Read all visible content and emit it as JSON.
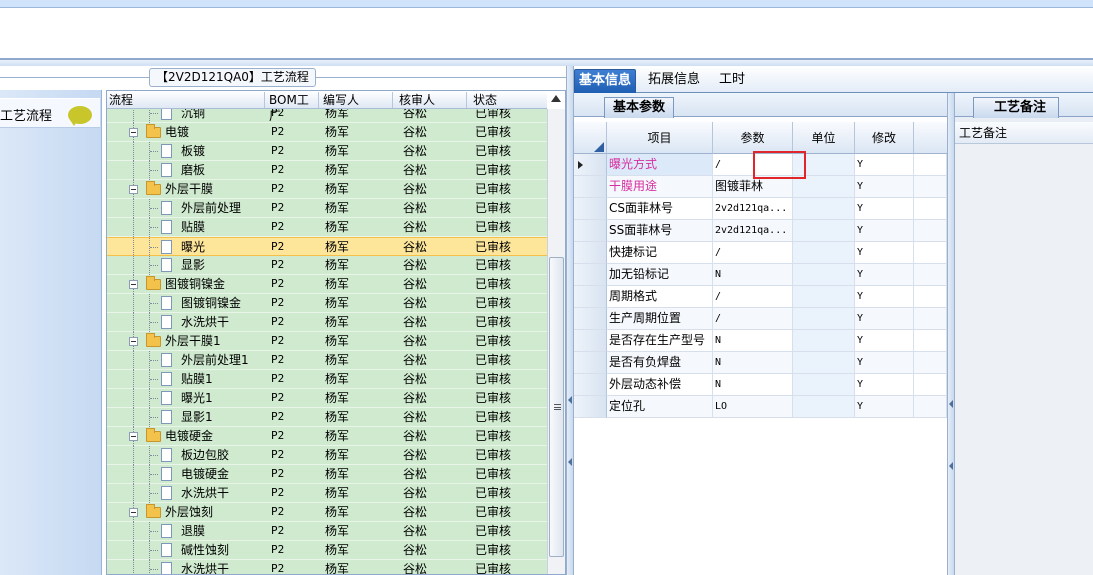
{
  "top_strip_text": "... P2 P2 ...",
  "tree": {
    "title": "【2V2D121QA0】工艺流程",
    "columns": {
      "flow": "流程",
      "bom": "BOM工厂",
      "writer": "编写人",
      "checker": "核审人",
      "status": "状态"
    },
    "rows": [
      {
        "label": "沉铜",
        "kind": "leaf",
        "bom": "P2",
        "writer": "杨军",
        "checker": "谷松",
        "status": "已审核"
      },
      {
        "label": "电镀",
        "kind": "folder",
        "bom": "P2",
        "writer": "杨军",
        "checker": "谷松",
        "status": "已审核"
      },
      {
        "label": "板镀",
        "kind": "leaf",
        "bom": "P2",
        "writer": "杨军",
        "checker": "谷松",
        "status": "已审核"
      },
      {
        "label": "磨板",
        "kind": "leaf",
        "bom": "P2",
        "writer": "杨军",
        "checker": "谷松",
        "status": "已审核"
      },
      {
        "label": "外层干膜",
        "kind": "folder",
        "bom": "P2",
        "writer": "杨军",
        "checker": "谷松",
        "status": "已审核"
      },
      {
        "label": "外层前处理",
        "kind": "leaf",
        "bom": "P2",
        "writer": "杨军",
        "checker": "谷松",
        "status": "已审核"
      },
      {
        "label": "贴膜",
        "kind": "leaf",
        "bom": "P2",
        "writer": "杨军",
        "checker": "谷松",
        "status": "已审核"
      },
      {
        "label": "曝光",
        "kind": "leaf",
        "bom": "P2",
        "writer": "杨军",
        "checker": "谷松",
        "status": "已审核",
        "selected": true
      },
      {
        "label": "显影",
        "kind": "leaf",
        "bom": "P2",
        "writer": "杨军",
        "checker": "谷松",
        "status": "已审核"
      },
      {
        "label": "图镀铜镍金",
        "kind": "folder",
        "bom": "P2",
        "writer": "杨军",
        "checker": "谷松",
        "status": "已审核"
      },
      {
        "label": "图镀铜镍金",
        "kind": "leaf",
        "bom": "P2",
        "writer": "杨军",
        "checker": "谷松",
        "status": "已审核"
      },
      {
        "label": "水洗烘干",
        "kind": "leaf",
        "bom": "P2",
        "writer": "杨军",
        "checker": "谷松",
        "status": "已审核"
      },
      {
        "label": "外层干膜1",
        "kind": "folder",
        "bom": "P2",
        "writer": "杨军",
        "checker": "谷松",
        "status": "已审核"
      },
      {
        "label": "外层前处理1",
        "kind": "leaf",
        "bom": "P2",
        "writer": "杨军",
        "checker": "谷松",
        "status": "已审核"
      },
      {
        "label": "贴膜1",
        "kind": "leaf",
        "bom": "P2",
        "writer": "杨军",
        "checker": "谷松",
        "status": "已审核"
      },
      {
        "label": "曝光1",
        "kind": "leaf",
        "bom": "P2",
        "writer": "杨军",
        "checker": "谷松",
        "status": "已审核"
      },
      {
        "label": "显影1",
        "kind": "leaf",
        "bom": "P2",
        "writer": "杨军",
        "checker": "谷松",
        "status": "已审核"
      },
      {
        "label": "电镀硬金",
        "kind": "folder",
        "bom": "P2",
        "writer": "杨军",
        "checker": "谷松",
        "status": "已审核"
      },
      {
        "label": "板边包胶",
        "kind": "leaf",
        "bom": "P2",
        "writer": "杨军",
        "checker": "谷松",
        "status": "已审核"
      },
      {
        "label": "电镀硬金",
        "kind": "leaf",
        "bom": "P2",
        "writer": "杨军",
        "checker": "谷松",
        "status": "已审核"
      },
      {
        "label": "水洗烘干",
        "kind": "leaf",
        "bom": "P2",
        "writer": "杨军",
        "checker": "谷松",
        "status": "已审核"
      },
      {
        "label": "外层蚀刻",
        "kind": "folder",
        "bom": "P2",
        "writer": "杨军",
        "checker": "谷松",
        "status": "已审核"
      },
      {
        "label": "退膜",
        "kind": "leaf",
        "bom": "P2",
        "writer": "杨军",
        "checker": "谷松",
        "status": "已审核"
      },
      {
        "label": "碱性蚀刻",
        "kind": "leaf",
        "bom": "P2",
        "writer": "杨军",
        "checker": "谷松",
        "status": "已审核"
      },
      {
        "label": "水洗烘干",
        "kind": "leaf",
        "bom": "P2",
        "writer": "杨军",
        "checker": "谷松",
        "status": "已审核"
      }
    ]
  },
  "left_nav": {
    "label": "工艺流程"
  },
  "tabs": [
    "基本信息",
    "拓展信息",
    "工时"
  ],
  "params": {
    "subtab": "基本参数",
    "headers": {
      "item": "项目",
      "param": "参数",
      "unit": "单位",
      "modify": "修改"
    },
    "rows": [
      {
        "item": "曝光方式",
        "param": "/",
        "unit": "",
        "modify": "Y",
        "pink": true,
        "current": true
      },
      {
        "item": "干膜用途",
        "param": "图镀菲林",
        "unit": "",
        "modify": "Y",
        "pink": true
      },
      {
        "item": "CS面菲林号",
        "param": "2v2d121qa...",
        "unit": "",
        "modify": "Y"
      },
      {
        "item": "SS面菲林号",
        "param": "2v2d121qa...",
        "unit": "",
        "modify": "Y"
      },
      {
        "item": "快捷标记",
        "param": "/",
        "unit": "",
        "modify": "Y"
      },
      {
        "item": "加无铅标记",
        "param": "N",
        "unit": "",
        "modify": "Y"
      },
      {
        "item": "周期格式",
        "param": "/",
        "unit": "",
        "modify": "Y"
      },
      {
        "item": "生产周期位置",
        "param": "/",
        "unit": "",
        "modify": "Y"
      },
      {
        "item": "是否存在生产型号",
        "param": "N",
        "unit": "",
        "modify": "Y"
      },
      {
        "item": "是否有负焊盘",
        "param": "N",
        "unit": "",
        "modify": "Y"
      },
      {
        "item": "外层动态补偿",
        "param": "N",
        "unit": "",
        "modify": "Y"
      },
      {
        "item": "定位孔",
        "param": "LO",
        "unit": "",
        "modify": "Y"
      }
    ]
  },
  "remark": {
    "tab": "工艺备注",
    "header": "工艺备注"
  },
  "colors": {
    "tree_row_bg": "#cfeacf",
    "selected_row": "#fde59a",
    "tab_active": "#2f6fc3",
    "pink_text": "#d62ea0",
    "highlight": "#e0262a"
  }
}
